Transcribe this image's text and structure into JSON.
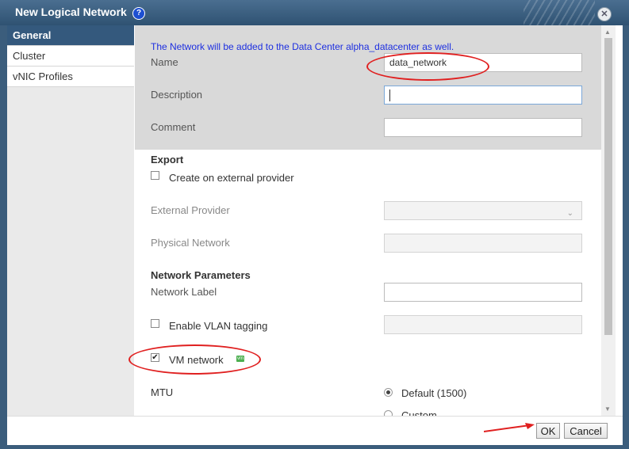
{
  "dialog": {
    "title": "New Logical Network",
    "help_icon": "?",
    "close_icon": "✕"
  },
  "sidebar": {
    "items": [
      {
        "label": "General"
      },
      {
        "label": "Cluster"
      },
      {
        "label": "vNIC Profiles"
      }
    ]
  },
  "form": {
    "info_text": "The Network will be added to the Data Center alpha_datacenter as well.",
    "name_label": "Name",
    "name_value": "data_network",
    "description_label": "Description",
    "description_value": "",
    "comment_label": "Comment",
    "comment_value": "",
    "export_heading": "Export",
    "create_external_label": "Create on external provider",
    "create_external_checked": false,
    "external_provider_label": "External Provider",
    "physical_network_label": "Physical Network",
    "network_params_heading": "Network Parameters",
    "network_label_label": "Network Label",
    "enable_vlan_label": "Enable VLAN tagging",
    "enable_vlan_checked": false,
    "vm_network_label": "VM network",
    "vm_network_checked": true,
    "vm_badge": "vm",
    "mtu_label": "MTU",
    "mtu_options": [
      {
        "label": "Default (1500)",
        "checked": true
      },
      {
        "label": "Custom",
        "checked": false
      }
    ]
  },
  "footer": {
    "ok_label": "OK",
    "cancel_label": "Cancel"
  },
  "colors": {
    "titlebar": "#3b5d7c",
    "nav_active": "#34597d",
    "info_text": "#1d2fe0",
    "annotation": "#e02020"
  }
}
